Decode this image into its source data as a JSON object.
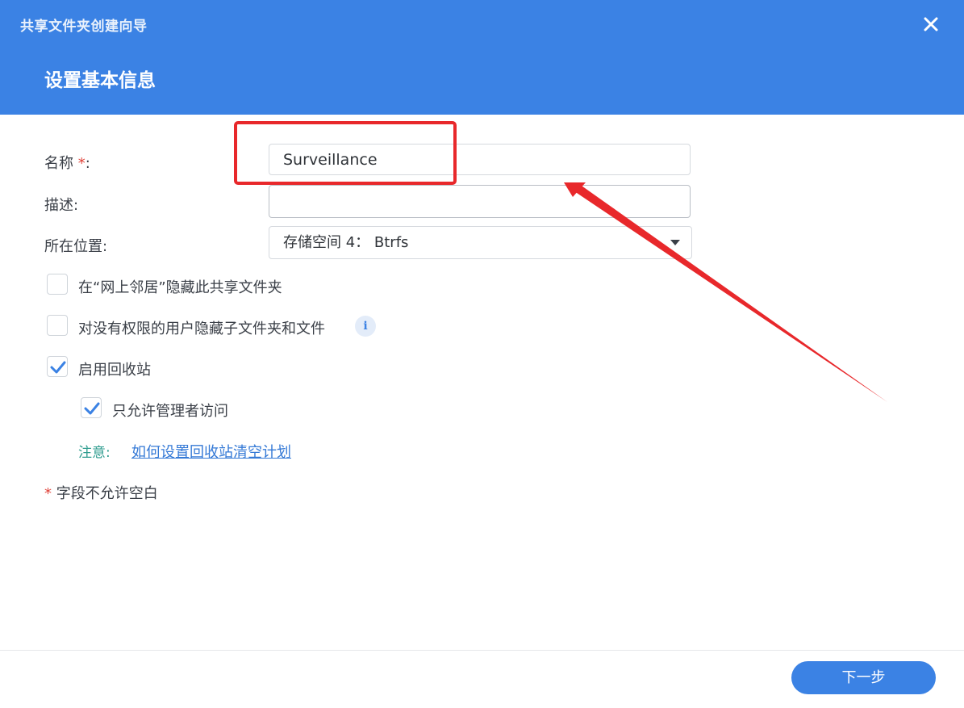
{
  "window": {
    "title": "共享文件夹创建向导",
    "close_icon": "close-icon"
  },
  "step": {
    "title": "设置基本信息"
  },
  "form": {
    "name_label": "名称",
    "name_required_mark": "*",
    "name_colon": ":",
    "name_value": "Surveillance",
    "desc_label": "描述:",
    "desc_value": "",
    "location_label": "所在位置:",
    "location_value": "存储空间 4： Btrfs"
  },
  "options": {
    "hide_network": {
      "label": "在“网上邻居”隐藏此共享文件夹",
      "checked": false
    },
    "hide_subfolders": {
      "label": "对没有权限的用户隐藏子文件夹和文件",
      "checked": false
    },
    "recycle_bin": {
      "label": "启用回收站",
      "checked": true
    },
    "admin_only": {
      "label": "只允许管理者访问",
      "checked": true
    }
  },
  "note": {
    "label": "注意:",
    "link": "如何设置回收站清空计划"
  },
  "required_note": {
    "mark": "*",
    "text": "字段不允许空白"
  },
  "footer": {
    "next_label": "下一步"
  },
  "colors": {
    "header": "#3b82e4",
    "annotation": "#e8282b",
    "check": "#3b82e4",
    "note_label": "#2f9c8f",
    "link": "#3479d6"
  }
}
